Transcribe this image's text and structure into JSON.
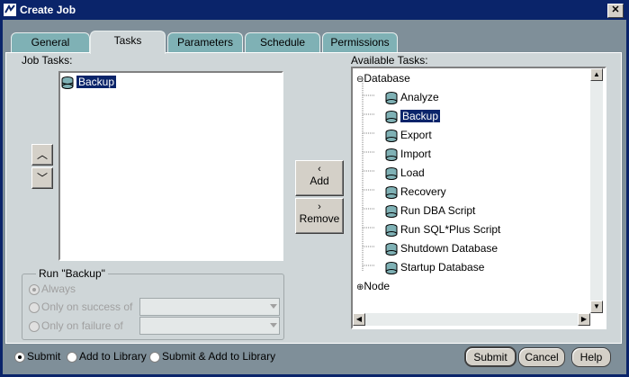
{
  "window": {
    "title": "Create Job"
  },
  "tabs": [
    "General",
    "Tasks",
    "Parameters",
    "Schedule",
    "Permissions"
  ],
  "job_tasks": {
    "label": "Job Tasks:",
    "items": [
      "Backup"
    ]
  },
  "available_tasks": {
    "label": "Available Tasks:",
    "groups": [
      {
        "name": "Database",
        "expanded": true,
        "items": [
          "Analyze",
          "Backup",
          "Export",
          "Import",
          "Load",
          "Recovery",
          "Run DBA Script",
          "Run SQL*Plus Script",
          "Shutdown Database",
          "Startup Database"
        ]
      },
      {
        "name": "Node",
        "expanded": false,
        "items": []
      }
    ]
  },
  "buttons": {
    "add": "Add",
    "remove": "Remove",
    "submit": "Submit",
    "cancel": "Cancel",
    "help": "Help"
  },
  "run_group": {
    "label": "Run \"Backup\"",
    "options": [
      "Always",
      "Only on success of",
      "Only on failure of"
    ]
  },
  "submit_options": [
    "Submit",
    "Add to Library",
    "Submit & Add to Library"
  ],
  "colors": {
    "selection": "#0a246a",
    "tab": "#7fb1b5",
    "panel": "#cfd6d8"
  }
}
